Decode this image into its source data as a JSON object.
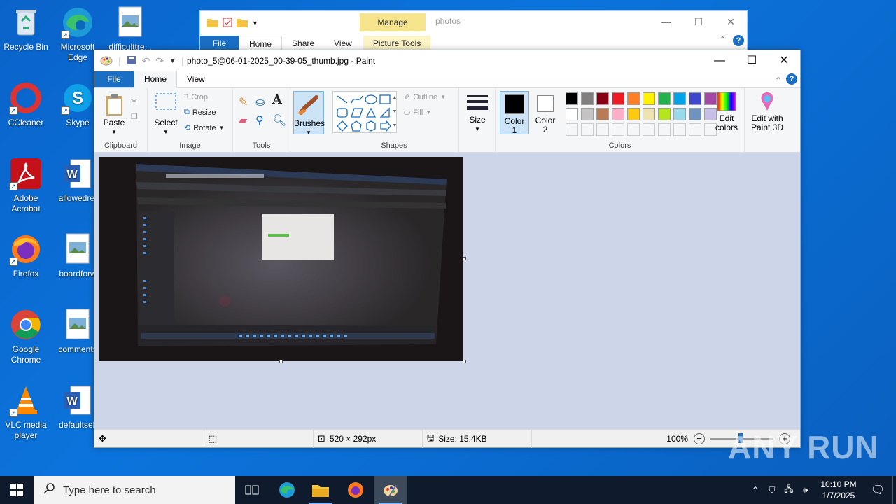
{
  "desktop": {
    "icons": [
      {
        "label": "Recycle Bin"
      },
      {
        "label": "Microsoft Edge"
      },
      {
        "label": "difficulttre..."
      },
      {
        "label": "CCleaner"
      },
      {
        "label": "Skype"
      },
      {
        "label": "Adobe Acrobat"
      },
      {
        "label": "allowedref"
      },
      {
        "label": "Firefox"
      },
      {
        "label": "boardforw"
      },
      {
        "label": "Google Chrome"
      },
      {
        "label": "comments"
      },
      {
        "label": "VLC media player"
      },
      {
        "label": "defaultsell"
      }
    ]
  },
  "explorer": {
    "title": "photos",
    "manage_label": "Manage",
    "tabs": {
      "file": "File",
      "home": "Home",
      "share": "Share",
      "view": "View",
      "picture_tools": "Picture Tools"
    }
  },
  "paint": {
    "title": "photo_5@06-01-2025_00-39-05_thumb.jpg - Paint",
    "tabs": {
      "file": "File",
      "home": "Home",
      "view": "View"
    },
    "clipboard": {
      "paste": "Paste",
      "group": "Clipboard"
    },
    "image": {
      "select": "Select",
      "crop": "Crop",
      "resize": "Resize",
      "rotate": "Rotate",
      "group": "Image"
    },
    "tools": {
      "group": "Tools"
    },
    "brushes": {
      "label": "Brushes"
    },
    "shapes": {
      "outline": "Outline",
      "fill": "Fill",
      "group": "Shapes"
    },
    "size": {
      "label": "Size"
    },
    "colors": {
      "color1_line1": "Color",
      "color1_line2": "1",
      "color2_line1": "Color",
      "color2_line2": "2",
      "edit_line1": "Edit",
      "edit_line2": "colors",
      "paint3d_line1": "Edit with",
      "paint3d_line2": "Paint 3D",
      "group": "Colors",
      "color1_value": "#000000",
      "color2_value": "#ffffff",
      "palette_row1": [
        "#000000",
        "#7f7f7f",
        "#880015",
        "#ed1c24",
        "#ff7f27",
        "#fff200",
        "#22b14c",
        "#00a2e8",
        "#3f48cc",
        "#a349a4"
      ],
      "palette_row2": [
        "#ffffff",
        "#c3c3c3",
        "#b97a57",
        "#ffaec9",
        "#ffc90e",
        "#efe4b0",
        "#b5e61d",
        "#99d9ea",
        "#7092be",
        "#c8bfe7"
      ]
    },
    "status": {
      "dimensions": "520 × 292px",
      "size": "Size: 15.4KB",
      "zoom": "100%"
    }
  },
  "taskbar": {
    "search_placeholder": "Type here to search",
    "time": "10:10 PM",
    "date": "1/7/2025"
  },
  "watermark": "ANY RUN"
}
